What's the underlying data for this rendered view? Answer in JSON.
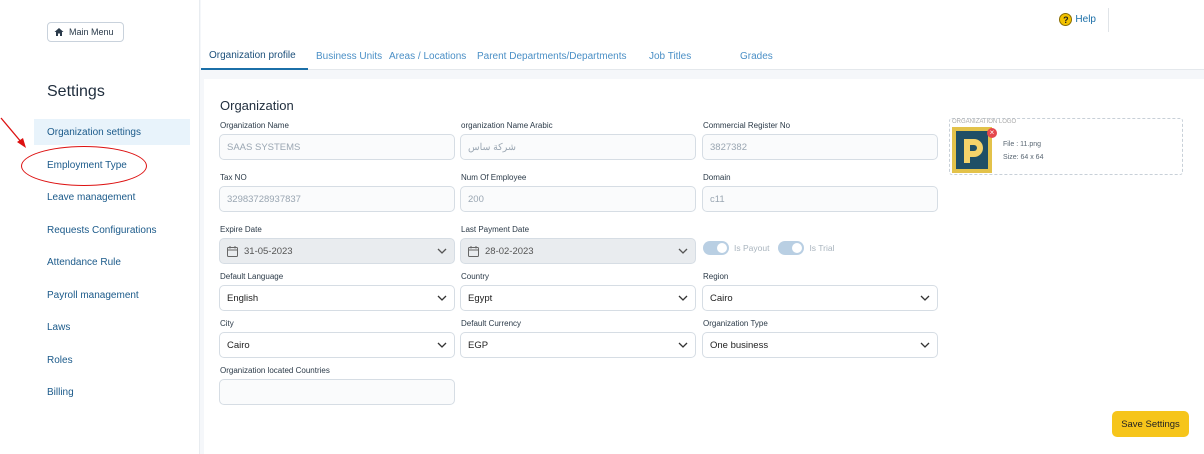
{
  "sidebar": {
    "main_menu_label": "Main Menu",
    "title": "Settings",
    "items": [
      {
        "label": "Organization settings"
      },
      {
        "label": "Employment Type"
      },
      {
        "label": "Leave management"
      },
      {
        "label": "Requests Configurations"
      },
      {
        "label": "Attendance Rule"
      },
      {
        "label": "Payroll management"
      },
      {
        "label": "Laws"
      },
      {
        "label": "Roles"
      },
      {
        "label": "Billing"
      }
    ]
  },
  "header": {
    "help_label": "Help",
    "tabs": [
      {
        "label": "Organization profile"
      },
      {
        "label": "Business Units"
      },
      {
        "label": "Areas / Locations"
      },
      {
        "label": "Parent Departments/Departments"
      },
      {
        "label": "Job Titles"
      },
      {
        "label": "Grades"
      }
    ]
  },
  "form": {
    "section_title": "Organization",
    "org_name": {
      "label": "Organization Name",
      "placeholder": "SAAS SYSTEMS"
    },
    "org_name_ar": {
      "label": "organization Name Arabic",
      "placeholder": "شركة ساس"
    },
    "commercial_reg": {
      "label": "Commercial Register No",
      "placeholder": "3827382"
    },
    "tax_no": {
      "label": "Tax NO",
      "placeholder": "32983728937837"
    },
    "num_employee": {
      "label": "Num Of Employee",
      "placeholder": "200"
    },
    "domain": {
      "label": "Domain",
      "placeholder": "c11"
    },
    "expire_date": {
      "label": "Expire Date",
      "value": "31-05-2023"
    },
    "last_payment": {
      "label": "Last Payment Date",
      "value": "28-02-2023"
    },
    "is_payout_label": "Is Payout",
    "is_trial_label": "Is Trial",
    "default_language": {
      "label": "Default Language",
      "value": "English"
    },
    "country": {
      "label": "Country",
      "value": "Egypt"
    },
    "region": {
      "label": "Region",
      "value": "Cairo"
    },
    "city": {
      "label": "City",
      "value": "Cairo"
    },
    "currency": {
      "label": "Default Currency",
      "value": "EGP"
    },
    "org_type": {
      "label": "Organization Type",
      "value": "One business"
    },
    "located_countries": {
      "label": "Organization located Countries"
    }
  },
  "logo": {
    "label": "ORGANIZATION LOGO",
    "file": "File : 11.png",
    "size": "Size: 64 x 64"
  },
  "save_label": "Save Settings",
  "colors": {
    "accent": "#1b6fa8",
    "save": "#f6c51b",
    "annotation": "#dd1111"
  }
}
